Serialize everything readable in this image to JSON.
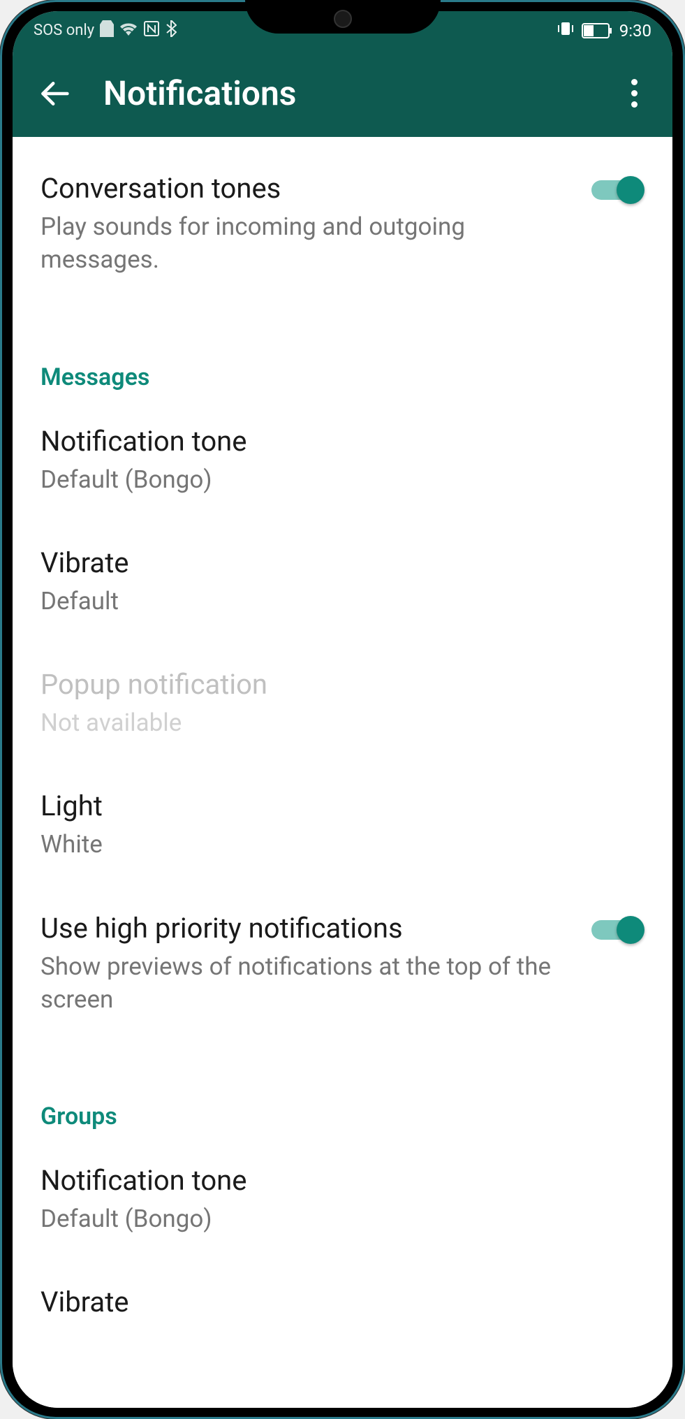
{
  "status_bar": {
    "left_text": "SOS only",
    "time": "9:30"
  },
  "header": {
    "title": "Notifications"
  },
  "items": {
    "conversation_tones": {
      "title": "Conversation tones",
      "subtitle": "Play sounds for incoming and outgoing messages."
    },
    "high_priority": {
      "title": "Use high priority notifications",
      "subtitle": "Show previews of notifications at the top of the screen"
    }
  },
  "sections": {
    "messages": {
      "header": "Messages",
      "notification_tone": {
        "title": "Notification tone",
        "value": "Default (Bongo)"
      },
      "vibrate": {
        "title": "Vibrate",
        "value": "Default"
      },
      "popup": {
        "title": "Popup notification",
        "value": "Not available"
      },
      "light": {
        "title": "Light",
        "value": "White"
      }
    },
    "groups": {
      "header": "Groups",
      "notification_tone": {
        "title": "Notification tone",
        "value": "Default (Bongo)"
      },
      "vibrate": {
        "title": "Vibrate"
      }
    }
  }
}
